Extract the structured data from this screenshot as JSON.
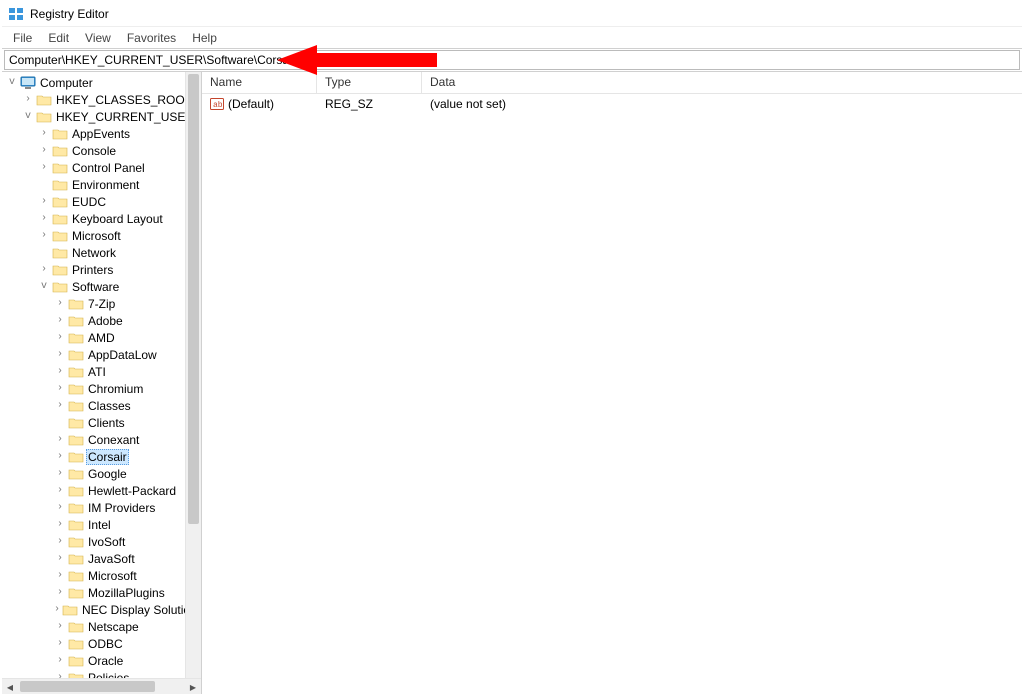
{
  "app": {
    "title": "Registry Editor"
  },
  "menu": {
    "file": "File",
    "edit": "Edit",
    "view": "View",
    "favorites": "Favorites",
    "help": "Help"
  },
  "address": {
    "path": "Computer\\HKEY_CURRENT_USER\\Software\\Corsair"
  },
  "cols": {
    "name": "Name",
    "type": "Type",
    "data": "Data"
  },
  "row": {
    "name": "(Default)",
    "type": "REG_SZ",
    "data": "(value not set)"
  },
  "tree": {
    "computer": "Computer",
    "hkcr": "HKEY_CLASSES_ROOT",
    "hkcu": "HKEY_CURRENT_USER",
    "appevents": "AppEvents",
    "console": "Console",
    "controlpanel": "Control Panel",
    "environment": "Environment",
    "eudc": "EUDC",
    "keyboard": "Keyboard Layout",
    "microsoft": "Microsoft",
    "network": "Network",
    "printers": "Printers",
    "software": "Software",
    "7zip": "7-Zip",
    "adobe": "Adobe",
    "amd": "AMD",
    "appdatalow": "AppDataLow",
    "ati": "ATI",
    "chromium": "Chromium",
    "classes": "Classes",
    "clients": "Clients",
    "conexant": "Conexant",
    "corsair": "Corsair",
    "google": "Google",
    "hp": "Hewlett-Packard",
    "improviders": "IM Providers",
    "intel": "Intel",
    "ivosoft": "IvoSoft",
    "javasoft": "JavaSoft",
    "microsoft2": "Microsoft",
    "mozillaplugins": "MozillaPlugins",
    "nec": "NEC Display Solutions",
    "netscape": "Netscape",
    "odbc": "ODBC",
    "oracle": "Oracle",
    "policies": "Policies"
  }
}
